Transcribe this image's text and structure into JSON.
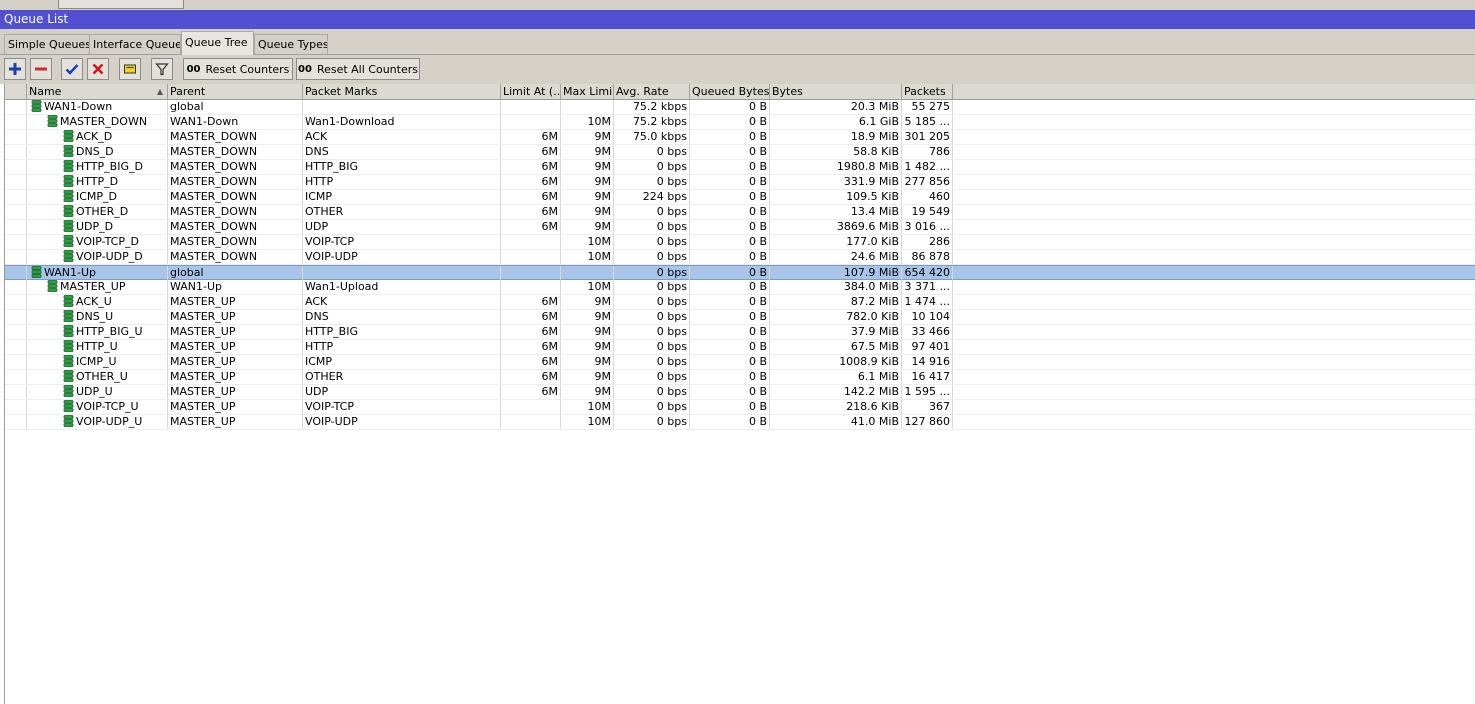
{
  "window": {
    "title": "Queue List"
  },
  "tabs": [
    {
      "label": "Simple Queues",
      "active": false
    },
    {
      "label": "Interface Queues",
      "active": false
    },
    {
      "label": "Queue Tree",
      "active": true
    },
    {
      "label": "Queue Types",
      "active": false
    }
  ],
  "toolbar": {
    "icons": [
      "add-icon",
      "remove-icon",
      "enable-check-icon",
      "disable-x-icon",
      "comment-icon",
      "filter-icon"
    ],
    "counter_badge": "00",
    "reset_counters_label": "Reset Counters",
    "reset_all_counters_label": "Reset All Counters"
  },
  "columns": {
    "name": "Name",
    "parent": "Parent",
    "packet_marks": "Packet Marks",
    "limit_at": "Limit At (...",
    "max_limit": "Max Limi...",
    "avg_rate": "Avg. Rate",
    "queued_bytes": "Queued Bytes",
    "bytes": "Bytes",
    "packets": "Packets"
  },
  "rows": [
    {
      "name": "WAN1-Down",
      "depth": 0,
      "parent": "global",
      "marks": "",
      "limit_at": "",
      "max_limit": "",
      "avg_rate": "75.2 kbps",
      "queued": "0 B",
      "bytes": "20.3 MiB",
      "packets": "55 275",
      "selected": false
    },
    {
      "name": "MASTER_DOWN",
      "depth": 1,
      "parent": "WAN1-Down",
      "marks": "Wan1-Download",
      "limit_at": "",
      "max_limit": "10M",
      "avg_rate": "75.2 kbps",
      "queued": "0 B",
      "bytes": "6.1 GiB",
      "packets": "5 185 ...",
      "selected": false
    },
    {
      "name": "ACK_D",
      "depth": 2,
      "parent": "MASTER_DOWN",
      "marks": "ACK",
      "limit_at": "6M",
      "max_limit": "9M",
      "avg_rate": "75.0 kbps",
      "queued": "0 B",
      "bytes": "18.9 MiB",
      "packets": "301 205",
      "selected": false
    },
    {
      "name": "DNS_D",
      "depth": 2,
      "parent": "MASTER_DOWN",
      "marks": "DNS",
      "limit_at": "6M",
      "max_limit": "9M",
      "avg_rate": "0 bps",
      "queued": "0 B",
      "bytes": "58.8 KiB",
      "packets": "786",
      "selected": false
    },
    {
      "name": "HTTP_BIG_D",
      "depth": 2,
      "parent": "MASTER_DOWN",
      "marks": "HTTP_BIG",
      "limit_at": "6M",
      "max_limit": "9M",
      "avg_rate": "0 bps",
      "queued": "0 B",
      "bytes": "1980.8 MiB",
      "packets": "1 482 ...",
      "selected": false
    },
    {
      "name": "HTTP_D",
      "depth": 2,
      "parent": "MASTER_DOWN",
      "marks": "HTTP",
      "limit_at": "6M",
      "max_limit": "9M",
      "avg_rate": "0 bps",
      "queued": "0 B",
      "bytes": "331.9 MiB",
      "packets": "277 856",
      "selected": false
    },
    {
      "name": "ICMP_D",
      "depth": 2,
      "parent": "MASTER_DOWN",
      "marks": "ICMP",
      "limit_at": "6M",
      "max_limit": "9M",
      "avg_rate": "224 bps",
      "queued": "0 B",
      "bytes": "109.5 KiB",
      "packets": "460",
      "selected": false
    },
    {
      "name": "OTHER_D",
      "depth": 2,
      "parent": "MASTER_DOWN",
      "marks": "OTHER",
      "limit_at": "6M",
      "max_limit": "9M",
      "avg_rate": "0 bps",
      "queued": "0 B",
      "bytes": "13.4 MiB",
      "packets": "19 549",
      "selected": false
    },
    {
      "name": "UDP_D",
      "depth": 2,
      "parent": "MASTER_DOWN",
      "marks": "UDP",
      "limit_at": "6M",
      "max_limit": "9M",
      "avg_rate": "0 bps",
      "queued": "0 B",
      "bytes": "3869.6 MiB",
      "packets": "3 016 ...",
      "selected": false
    },
    {
      "name": "VOIP-TCP_D",
      "depth": 2,
      "parent": "MASTER_DOWN",
      "marks": "VOIP-TCP",
      "limit_at": "",
      "max_limit": "10M",
      "avg_rate": "0 bps",
      "queued": "0 B",
      "bytes": "177.0 KiB",
      "packets": "286",
      "selected": false
    },
    {
      "name": "VOIP-UDP_D",
      "depth": 2,
      "parent": "MASTER_DOWN",
      "marks": "VOIP-UDP",
      "limit_at": "",
      "max_limit": "10M",
      "avg_rate": "0 bps",
      "queued": "0 B",
      "bytes": "24.6 MiB",
      "packets": "86 878",
      "selected": false
    },
    {
      "name": "WAN1-Up",
      "depth": 0,
      "parent": "global",
      "marks": "",
      "limit_at": "",
      "max_limit": "",
      "avg_rate": "0 bps",
      "queued": "0 B",
      "bytes": "107.9 MiB",
      "packets": "654 420",
      "selected": true
    },
    {
      "name": "MASTER_UP",
      "depth": 1,
      "parent": "WAN1-Up",
      "marks": "Wan1-Upload",
      "limit_at": "",
      "max_limit": "10M",
      "avg_rate": "0 bps",
      "queued": "0 B",
      "bytes": "384.0 MiB",
      "packets": "3 371 ...",
      "selected": false
    },
    {
      "name": "ACK_U",
      "depth": 2,
      "parent": "MASTER_UP",
      "marks": "ACK",
      "limit_at": "6M",
      "max_limit": "9M",
      "avg_rate": "0 bps",
      "queued": "0 B",
      "bytes": "87.2 MiB",
      "packets": "1 474 ...",
      "selected": false
    },
    {
      "name": "DNS_U",
      "depth": 2,
      "parent": "MASTER_UP",
      "marks": "DNS",
      "limit_at": "6M",
      "max_limit": "9M",
      "avg_rate": "0 bps",
      "queued": "0 B",
      "bytes": "782.0 KiB",
      "packets": "10 104",
      "selected": false
    },
    {
      "name": "HTTP_BIG_U",
      "depth": 2,
      "parent": "MASTER_UP",
      "marks": "HTTP_BIG",
      "limit_at": "6M",
      "max_limit": "9M",
      "avg_rate": "0 bps",
      "queued": "0 B",
      "bytes": "37.9 MiB",
      "packets": "33 466",
      "selected": false
    },
    {
      "name": "HTTP_U",
      "depth": 2,
      "parent": "MASTER_UP",
      "marks": "HTTP",
      "limit_at": "6M",
      "max_limit": "9M",
      "avg_rate": "0 bps",
      "queued": "0 B",
      "bytes": "67.5 MiB",
      "packets": "97 401",
      "selected": false
    },
    {
      "name": "ICMP_U",
      "depth": 2,
      "parent": "MASTER_UP",
      "marks": "ICMP",
      "limit_at": "6M",
      "max_limit": "9M",
      "avg_rate": "0 bps",
      "queued": "0 B",
      "bytes": "1008.9 KiB",
      "packets": "14 916",
      "selected": false
    },
    {
      "name": "OTHER_U",
      "depth": 2,
      "parent": "MASTER_UP",
      "marks": "OTHER",
      "limit_at": "6M",
      "max_limit": "9M",
      "avg_rate": "0 bps",
      "queued": "0 B",
      "bytes": "6.1 MiB",
      "packets": "16 417",
      "selected": false
    },
    {
      "name": "UDP_U",
      "depth": 2,
      "parent": "MASTER_UP",
      "marks": "UDP",
      "limit_at": "6M",
      "max_limit": "9M",
      "avg_rate": "0 bps",
      "queued": "0 B",
      "bytes": "142.2 MiB",
      "packets": "1 595 ...",
      "selected": false
    },
    {
      "name": "VOIP-TCP_U",
      "depth": 2,
      "parent": "MASTER_UP",
      "marks": "VOIP-TCP",
      "limit_at": "",
      "max_limit": "10M",
      "avg_rate": "0 bps",
      "queued": "0 B",
      "bytes": "218.6 KiB",
      "packets": "367",
      "selected": false
    },
    {
      "name": "VOIP-UDP_U",
      "depth": 2,
      "parent": "MASTER_UP",
      "marks": "VOIP-UDP",
      "limit_at": "",
      "max_limit": "10M",
      "avg_rate": "0 bps",
      "queued": "0 B",
      "bytes": "41.0 MiB",
      "packets": "127 860",
      "selected": false
    }
  ],
  "colors": {
    "title_bar": "#5050d0",
    "selected_row": "#a8c4e8",
    "queue_icon": "#2ea043",
    "add_icon": "#1a3fb0",
    "remove_icon": "#c03030",
    "check_icon": "#1a3fb0",
    "x_icon": "#d01818",
    "comment_icon": "#f0d020"
  }
}
